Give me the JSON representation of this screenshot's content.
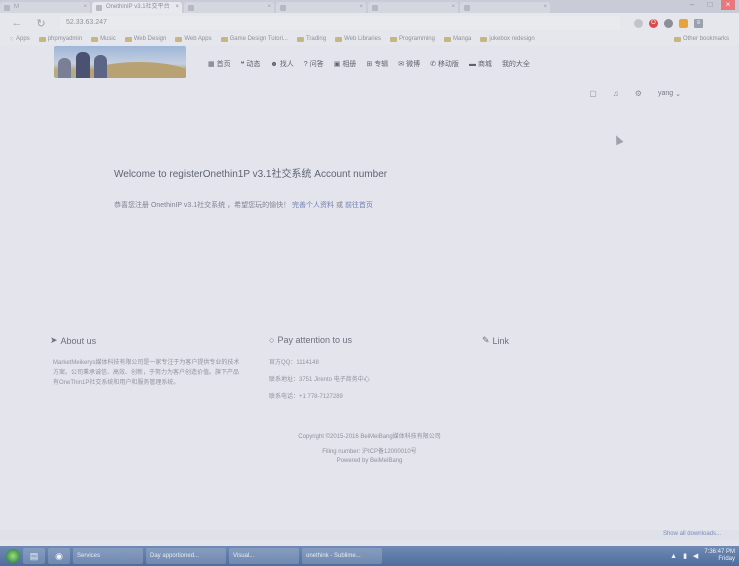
{
  "browser": {
    "tabs": [
      {
        "label": "M",
        "active": false
      },
      {
        "label": "OnethinIP v3.1社交平台",
        "active": true
      },
      {
        "label": "",
        "active": false
      },
      {
        "label": "",
        "active": false
      },
      {
        "label": "",
        "active": false
      },
      {
        "label": "",
        "active": false
      }
    ],
    "url": "52.33.63.247",
    "bookmarks": [
      "Apps",
      "phpmyadmin",
      "Music",
      "Web Design",
      "Web Apps",
      "Game Design Tutori...",
      "Trading",
      "Web Libraries",
      "Programming",
      "Manga",
      "jukebox redesign"
    ],
    "other_bookmarks": "Other bookmarks"
  },
  "site": {
    "nav": [
      {
        "icon": "home-icon",
        "glyph": "▦",
        "label": "首页"
      },
      {
        "icon": "activity-icon",
        "glyph": "❝",
        "label": "动态"
      },
      {
        "icon": "people-icon",
        "glyph": "☻",
        "label": "找人"
      },
      {
        "icon": "question-icon",
        "glyph": "?",
        "label": "问答"
      },
      {
        "icon": "picture-icon",
        "glyph": "▣",
        "label": "相册"
      },
      {
        "icon": "board-icon",
        "glyph": "⊞",
        "label": "专辑"
      },
      {
        "icon": "mail-icon",
        "glyph": "✉",
        "label": "微博"
      },
      {
        "icon": "phone-icon",
        "glyph": "✆",
        "label": "移动版"
      },
      {
        "icon": "cart-icon",
        "glyph": "▬",
        "label": "商城"
      },
      {
        "icon": "",
        "glyph": "",
        "label": "我的大全"
      }
    ],
    "user_name": "yang"
  },
  "welcome": {
    "title": "Welcome to registerOnethin1P v3.1社交系统 Account number",
    "sub_prefix": "恭喜您注册 OnethinIP v3.1社交系统 ，希望您玩的愉快！",
    "sub_link1": "完善个人资料",
    "sub_or": "或",
    "sub_link2": "前往首页"
  },
  "footer": {
    "about_title": "About us",
    "about_text": "MarketMeikerys媒体科技有限公司是一家专注于为客户提供专业的技术方案。公司秉承诚信、高效、创新，于努力为客户创造价值。旗下产品有OneThin1P社交系统和用户和服务管理系统。",
    "contact_title": "Pay attention to us",
    "qq": "官方QQ：1114148",
    "address": "联系地址：3751 Jirento 电子商务中心",
    "phone": "联系电话：+1 778-7127289",
    "link_title": "Link",
    "copyright": "Copyright ©2015-2016 BeiMeiBang媒体科技有限公司",
    "filing": "Filing number: 沪ICP备12000010号",
    "powered": "Powered by BeiMeiBang"
  },
  "status_url": "personaxoff",
  "downloads": {
    "show_all": "Show all downloads..."
  },
  "taskbar": {
    "items": [
      "Services",
      "Day apportioned...",
      "Visual...",
      "onethink - Sublime..."
    ],
    "time": "7:36:47 PM",
    "day": "Friday"
  }
}
